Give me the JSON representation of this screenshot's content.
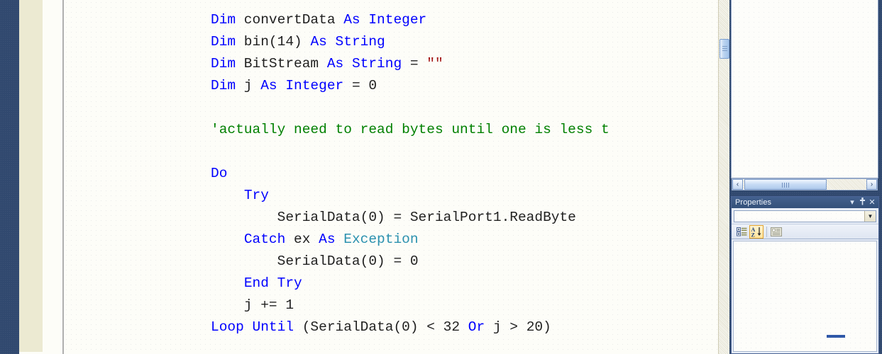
{
  "window": {
    "theme_accent": "#31496f",
    "editor_background": "#fdfdf8"
  },
  "editor": {
    "name": "code-editor",
    "language": "Visual Basic",
    "syntax_colors": {
      "keyword": "#0000ff",
      "type": "#0000ff",
      "class": "#2b91af",
      "comment": "#008000",
      "string": "#a31515",
      "identifier": "#212121"
    },
    "code_lines": [
      [
        {
          "t": "Dim",
          "c": "kw"
        },
        {
          "t": " convertData ",
          "c": "idn"
        },
        {
          "t": "As",
          "c": "kw"
        },
        {
          "t": " ",
          "c": "idn"
        },
        {
          "t": "Integer",
          "c": "typ"
        }
      ],
      [
        {
          "t": "Dim",
          "c": "kw"
        },
        {
          "t": " bin(14) ",
          "c": "idn"
        },
        {
          "t": "As",
          "c": "kw"
        },
        {
          "t": " ",
          "c": "idn"
        },
        {
          "t": "String",
          "c": "typ"
        }
      ],
      [
        {
          "t": "Dim",
          "c": "kw"
        },
        {
          "t": " BitStream ",
          "c": "idn"
        },
        {
          "t": "As",
          "c": "kw"
        },
        {
          "t": " ",
          "c": "idn"
        },
        {
          "t": "String",
          "c": "typ"
        },
        {
          "t": " = ",
          "c": "idn"
        },
        {
          "t": "\"\"",
          "c": "str"
        }
      ],
      [
        {
          "t": "Dim",
          "c": "kw"
        },
        {
          "t": " j ",
          "c": "idn"
        },
        {
          "t": "As",
          "c": "kw"
        },
        {
          "t": " ",
          "c": "idn"
        },
        {
          "t": "Integer",
          "c": "typ"
        },
        {
          "t": " = 0",
          "c": "idn"
        }
      ],
      [],
      [
        {
          "t": "'actually need to read bytes until one is less t",
          "c": "cmt"
        }
      ],
      [],
      [
        {
          "t": "Do",
          "c": "kw"
        }
      ],
      [
        {
          "t": "    ",
          "c": "idn"
        },
        {
          "t": "Try",
          "c": "kw"
        }
      ],
      [
        {
          "t": "        SerialData(0) = SerialPort1.ReadByte",
          "c": "idn"
        }
      ],
      [
        {
          "t": "    ",
          "c": "idn"
        },
        {
          "t": "Catch",
          "c": "kw"
        },
        {
          "t": " ex ",
          "c": "idn"
        },
        {
          "t": "As",
          "c": "kw"
        },
        {
          "t": " ",
          "c": "idn"
        },
        {
          "t": "Exception",
          "c": "cls"
        }
      ],
      [
        {
          "t": "        SerialData(0) = 0",
          "c": "idn"
        }
      ],
      [
        {
          "t": "    ",
          "c": "idn"
        },
        {
          "t": "End Try",
          "c": "kw"
        }
      ],
      [
        {
          "t": "    j += 1",
          "c": "idn"
        }
      ],
      [
        {
          "t": "Loop Until",
          "c": "kw"
        },
        {
          "t": " (SerialData(0) < 32 ",
          "c": "idn"
        },
        {
          "t": "Or",
          "c": "kw"
        },
        {
          "t": " j > 20)",
          "c": "idn"
        }
      ]
    ]
  },
  "upper_panel": {
    "name": "upper-tool-window",
    "hscrollbar": {
      "left_arrow": "‹",
      "right_arrow": "›"
    }
  },
  "properties_panel": {
    "title": "Properties",
    "titlebar_buttons": [
      {
        "name": "window-menu-icon",
        "glyph": "▾"
      },
      {
        "name": "auto-hide-pin-icon",
        "glyph": "⚓"
      },
      {
        "name": "close-icon",
        "glyph": "✕"
      }
    ],
    "object_combo": {
      "value": "",
      "placeholder": "",
      "arrow": "▼"
    },
    "toolbar": [
      {
        "name": "categorized-view-button",
        "label": "Categorized",
        "active": false
      },
      {
        "name": "alphabetical-sort-button",
        "label": "Alphabetical",
        "active": true
      },
      {
        "name": "property-pages-button",
        "label": "Property Pages",
        "active": false
      }
    ],
    "grid_rows": []
  }
}
